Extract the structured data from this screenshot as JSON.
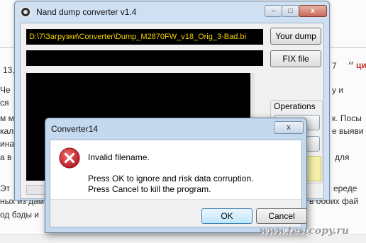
{
  "background_page": {
    "date_fragment": "13,",
    "number_fragment": "7",
    "tag_fragment": "ци",
    "lines": [
      {
        "left": "Че",
        "right": "у и"
      },
      {
        "left": "ся",
        "right": ""
      },
      {
        "left": "м м",
        "right": "к. Посы"
      },
      {
        "left": "кал.",
        "right": "е выяви"
      },
      {
        "left": "ина",
        "right": ""
      },
      {
        "left": "а в",
        "right": "для"
      },
      {
        "left": "Эт",
        "right": "ереде"
      },
      {
        "left": "ных из дам",
        "right": "в обоих фай"
      },
      {
        "left": "од бэды и",
        "right": ""
      }
    ]
  },
  "app_window": {
    "title": "Nand dump converter v1.4",
    "path_value": "D:\\7\\Загрузки\\Converter\\Dump_M2870FW_v18_Orig_3-Bad.bi",
    "your_dump_label": "Your dump",
    "fix_file_label": "FIX file",
    "operations_label": "Operations",
    "caption_minimize": "–",
    "caption_maximize": "□",
    "caption_close": "x"
  },
  "dialog": {
    "title": "Converter14",
    "close_glyph": "x",
    "message_title": "Invalid filename.",
    "message_line1": "Press OK to ignore and risk data corruption.",
    "message_line2": "Press Cancel to kill the program.",
    "ok_label": "OK",
    "cancel_label": "Cancel",
    "icon": "error-icon"
  },
  "watermark": "www.testcopy.ru",
  "colors": {
    "path_text": "#f2d000",
    "error_red": "#c9242b",
    "title_bar": "#cfe0f2"
  }
}
